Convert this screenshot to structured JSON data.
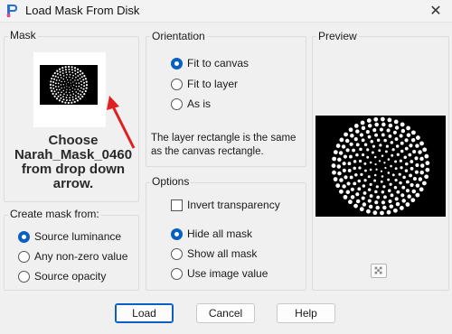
{
  "window": {
    "title": "Load Mask From Disk",
    "close_glyph": "✕"
  },
  "mask": {
    "group_label": "Mask",
    "overlay_text": [
      "Choose",
      "Narah_Mask_0460",
      "from drop down",
      "arrow."
    ]
  },
  "create_from": {
    "group_label": "Create mask from:",
    "options": [
      {
        "label": "Source luminance",
        "checked": true
      },
      {
        "label": "Any non-zero value",
        "checked": false
      },
      {
        "label": "Source opacity",
        "checked": false
      }
    ]
  },
  "orientation": {
    "group_label": "Orientation",
    "options": [
      {
        "label": "Fit to canvas",
        "checked": true
      },
      {
        "label": "Fit to layer",
        "checked": false
      },
      {
        "label": "As is",
        "checked": false
      }
    ],
    "note": "The layer rectangle is the same as the canvas rectangle."
  },
  "options": {
    "group_label": "Options",
    "invert_label": "Invert transparency",
    "invert_checked": false,
    "radios": [
      {
        "label": "Hide all mask",
        "checked": true
      },
      {
        "label": "Show all mask",
        "checked": false
      },
      {
        "label": "Use image value",
        "checked": false
      }
    ]
  },
  "preview": {
    "group_label": "Preview"
  },
  "buttons": {
    "load": "Load",
    "cancel": "Cancel",
    "help": "Help"
  },
  "colors": {
    "accent": "#0a5fc2",
    "arrow": "#e02020"
  },
  "icons": [
    "app-icon",
    "close-icon",
    "arrow-pointer-icon",
    "checkerboard-icon"
  ]
}
